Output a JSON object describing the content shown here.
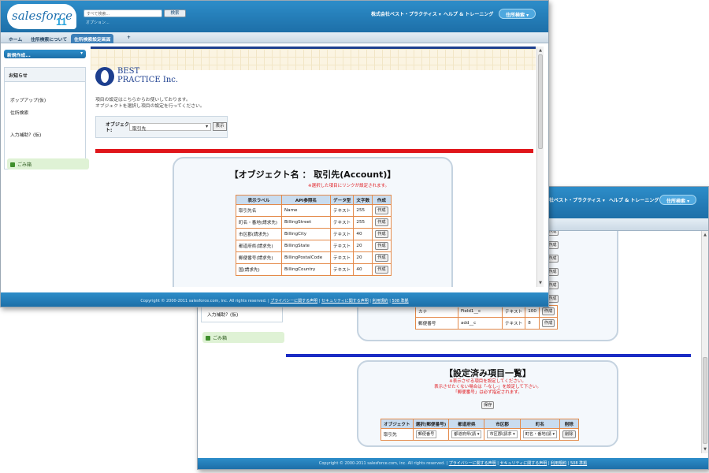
{
  "front": {
    "logo": {
      "brand": "salesforce",
      "version": "11"
    },
    "search": {
      "placeholder": "すべて検索...",
      "button": "検索",
      "option": "オプション..."
    },
    "header": {
      "company": "株式会社ベスト・プラクティス ▾",
      "help": "ヘルプ & トレーニング",
      "app": "住所検索 ▾"
    },
    "tabs": [
      "ホーム",
      "住所検索について",
      "住所検索設定画面",
      "+"
    ],
    "sidebar": {
      "new_button": "新規作成...",
      "box_title": "お知らせ",
      "items": [
        "ポップアップ(仮)",
        "住所検索",
        "入力補助？(仮)"
      ],
      "recycle": "ごみ箱"
    },
    "brand_logo": {
      "line1": "BEST",
      "line2": "PRACTICE Inc."
    },
    "description": [
      "項目の設定はこちらからお使いしております。",
      "オブジェクトを選択し項目の設定を行ってください。"
    ],
    "object_select": {
      "label": "オブジェクト:",
      "value": "取引先",
      "button": "表示"
    },
    "panel": {
      "title": "【オブジェクト名 ： 取引先(Account)】",
      "note": "※選択した項目にリンクが設定されます。",
      "headers": [
        "表示ラベル",
        "API参照名",
        "データ型",
        "文字数",
        "作成"
      ],
      "rows": [
        [
          "取引先名",
          "Name",
          "テキスト",
          "255",
          "作成"
        ],
        [
          "町名・番地(請求先)",
          "BillingStreet",
          "テキスト",
          "255",
          "作成"
        ],
        [
          "市区郡(請求先)",
          "BillingCity",
          "テキスト",
          "40",
          "作成"
        ],
        [
          "都道府県(請求先)",
          "BillingState",
          "テキスト",
          "20",
          "作成"
        ],
        [
          "郵便番号(請求先)",
          "BillingPostalCode",
          "テキスト",
          "20",
          "作成"
        ],
        [
          "国(請求先)",
          "BillingCountry",
          "テキスト",
          "40",
          "作成"
        ]
      ]
    },
    "footer": {
      "copyright": "Copyright © 2000-2011 salesforce.com, inc. All rights reserved. |",
      "links": [
        "プライバシーに関する声明",
        "セキュリティに関する声明",
        "利用規約",
        "508 準拠"
      ]
    }
  },
  "back": {
    "header": {
      "company": "会社ベスト・プラクティス ▾",
      "help": "ヘルプ & トレーニング",
      "app": "住所検索 ▾"
    },
    "sidebar": {
      "item": "入力補助？(仮)",
      "recycle": "ごみ箱"
    },
    "upper_rows": [
      [
        "カナ",
        "Field1__c",
        "テキスト",
        "100",
        "作成"
      ],
      [
        "郵便番号",
        "add__c",
        "テキスト",
        "8",
        "作成"
      ]
    ],
    "create_label": "作成",
    "settings": {
      "title": "【設定済み項目一覧】",
      "notes": [
        "※表示させる項目を設定してください。",
        "表示させたくない場合は「-なし-」を設定して下さい。",
        "「郵便番号」は必ず指定されます。"
      ],
      "save": "保存",
      "headers": [
        "オブジェクト",
        "選択(郵便番号)",
        "都道府県",
        "市区郡",
        "町名",
        "削除"
      ],
      "row": [
        "取引先",
        "郵便番号",
        "都道府県(請 ▾",
        "市区郡(請求 ▾",
        "町名・番地(請 ▾",
        "削除"
      ]
    },
    "footer": {
      "copyright": "Copyright © 2000-2011 salesforce.com, inc. All rights reserved. |",
      "links": [
        "プライバシーに関する声明",
        "セキュリティに関する声明",
        "利用規約",
        "508 準拠"
      ]
    }
  },
  "colors": {
    "header_blue": "#1d6fa8",
    "red_bar": "#e0161b",
    "blue_bar": "#1b2cc4",
    "table_border": "#e48a4a",
    "table_head": "#c9dcef"
  }
}
